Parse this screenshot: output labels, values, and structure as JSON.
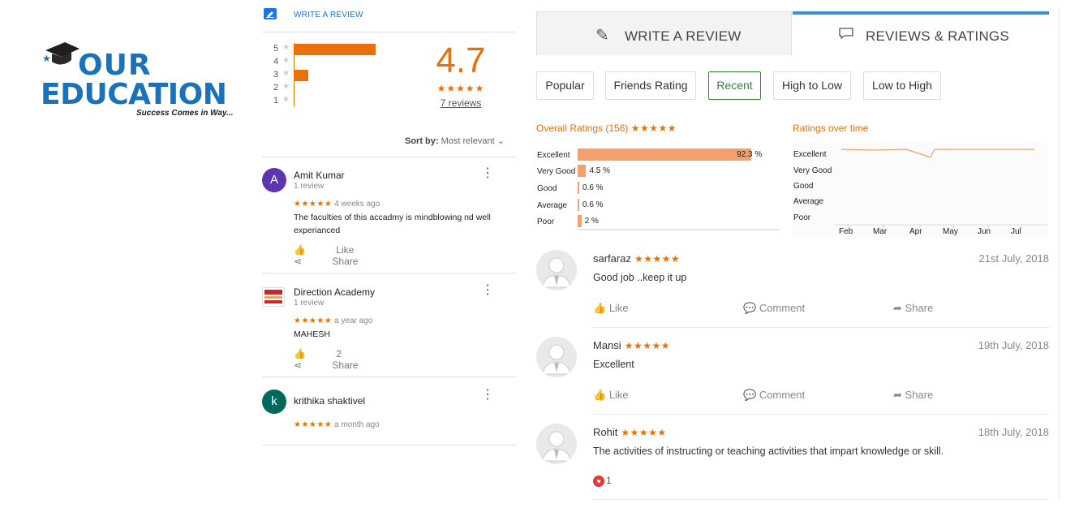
{
  "logo": {
    "line1": "OUR",
    "line2": "EDUCATION",
    "tagline": "Success Comes in Way..."
  },
  "google": {
    "write_review": "WRITE A REVIEW",
    "histogram": [
      {
        "star": "5",
        "fraction": 1.0
      },
      {
        "star": "4",
        "fraction": 0.0
      },
      {
        "star": "3",
        "fraction": 0.18
      },
      {
        "star": "2",
        "fraction": 0.0
      },
      {
        "star": "1",
        "fraction": 0.0
      }
    ],
    "star_glyph": "★",
    "average": "4.7",
    "average_stars": "★★★★★",
    "review_count": "7 reviews",
    "sort_label": "Sort by:",
    "sort_value": "Most relevant",
    "reviews": [
      {
        "initial": "A",
        "avatar_color": "#5e35b1",
        "name": "Amit Kumar",
        "sub": "1 review",
        "stars": "★★★★★",
        "when": "4 weeks ago",
        "text": "The faculties of this accadmy is mindblowing nd well experianced",
        "like": "Like",
        "share": "Share"
      },
      {
        "initial": "",
        "avatar_color": "#ffffff",
        "name": "Direction Academy",
        "sub": "1 review",
        "stars": "★★★★★",
        "when": "a year ago",
        "text": "MAHESH",
        "like": "2",
        "share": "Share"
      },
      {
        "initial": "k",
        "avatar_color": "#00695c",
        "name": "krithika shaktivel",
        "sub": "",
        "stars": "★★★★★",
        "when": "a month ago",
        "text": "",
        "like": "",
        "share": ""
      }
    ]
  },
  "right": {
    "tabs": [
      "WRITE A REVIEW",
      "REVIEWS & RATINGS"
    ],
    "filters": [
      "Popular",
      "Friends Rating",
      "Recent",
      "High to Low",
      "Low to High"
    ],
    "active_filter": "Recent",
    "overall_title": "Overall Ratings (156)",
    "overall_stars": "★★★★★",
    "time_title": "Ratings over time",
    "reviews": [
      {
        "name": "sarfaraz",
        "stars": "★★★★★",
        "date": "21st July, 2018",
        "text": "Good job ..keep it up",
        "like": "Like",
        "comment": "Comment",
        "share": "Share"
      },
      {
        "name": "Mansi",
        "stars": "★★★★★",
        "date": "19th July, 2018",
        "text": "Excellent",
        "like": "Like",
        "comment": "Comment",
        "share": "Share"
      },
      {
        "name": "Rohit",
        "stars": "★★★★★",
        "date": "18th July, 2018",
        "text": "The activities of instructing or teaching activities that impart knowledge or skill.",
        "hearts": "1"
      }
    ]
  },
  "chart_data": [
    {
      "type": "bar",
      "title": "Overall Ratings (156)",
      "categories": [
        "Excellent",
        "Very Good",
        "Good",
        "Average",
        "Poor"
      ],
      "values": [
        92.3,
        4.5,
        0.6,
        0.6,
        2
      ],
      "labels": [
        "92.3 %",
        "4.5 %",
        "0.6 %",
        "0.6 %",
        "2 %"
      ],
      "xlim": [
        0,
        100
      ],
      "color": "#f4a06a"
    },
    {
      "type": "line",
      "title": "Ratings over time",
      "x": [
        "Feb",
        "Mar",
        "Apr",
        "May",
        "Jun",
        "Jul"
      ],
      "y_categories": [
        "Excellent",
        "Very Good",
        "Good",
        "Average",
        "Poor"
      ],
      "series": [
        {
          "values": [
            5,
            4.95,
            5,
            4.5,
            5,
            5,
            5
          ]
        }
      ],
      "color": "#f4a06a"
    }
  ]
}
